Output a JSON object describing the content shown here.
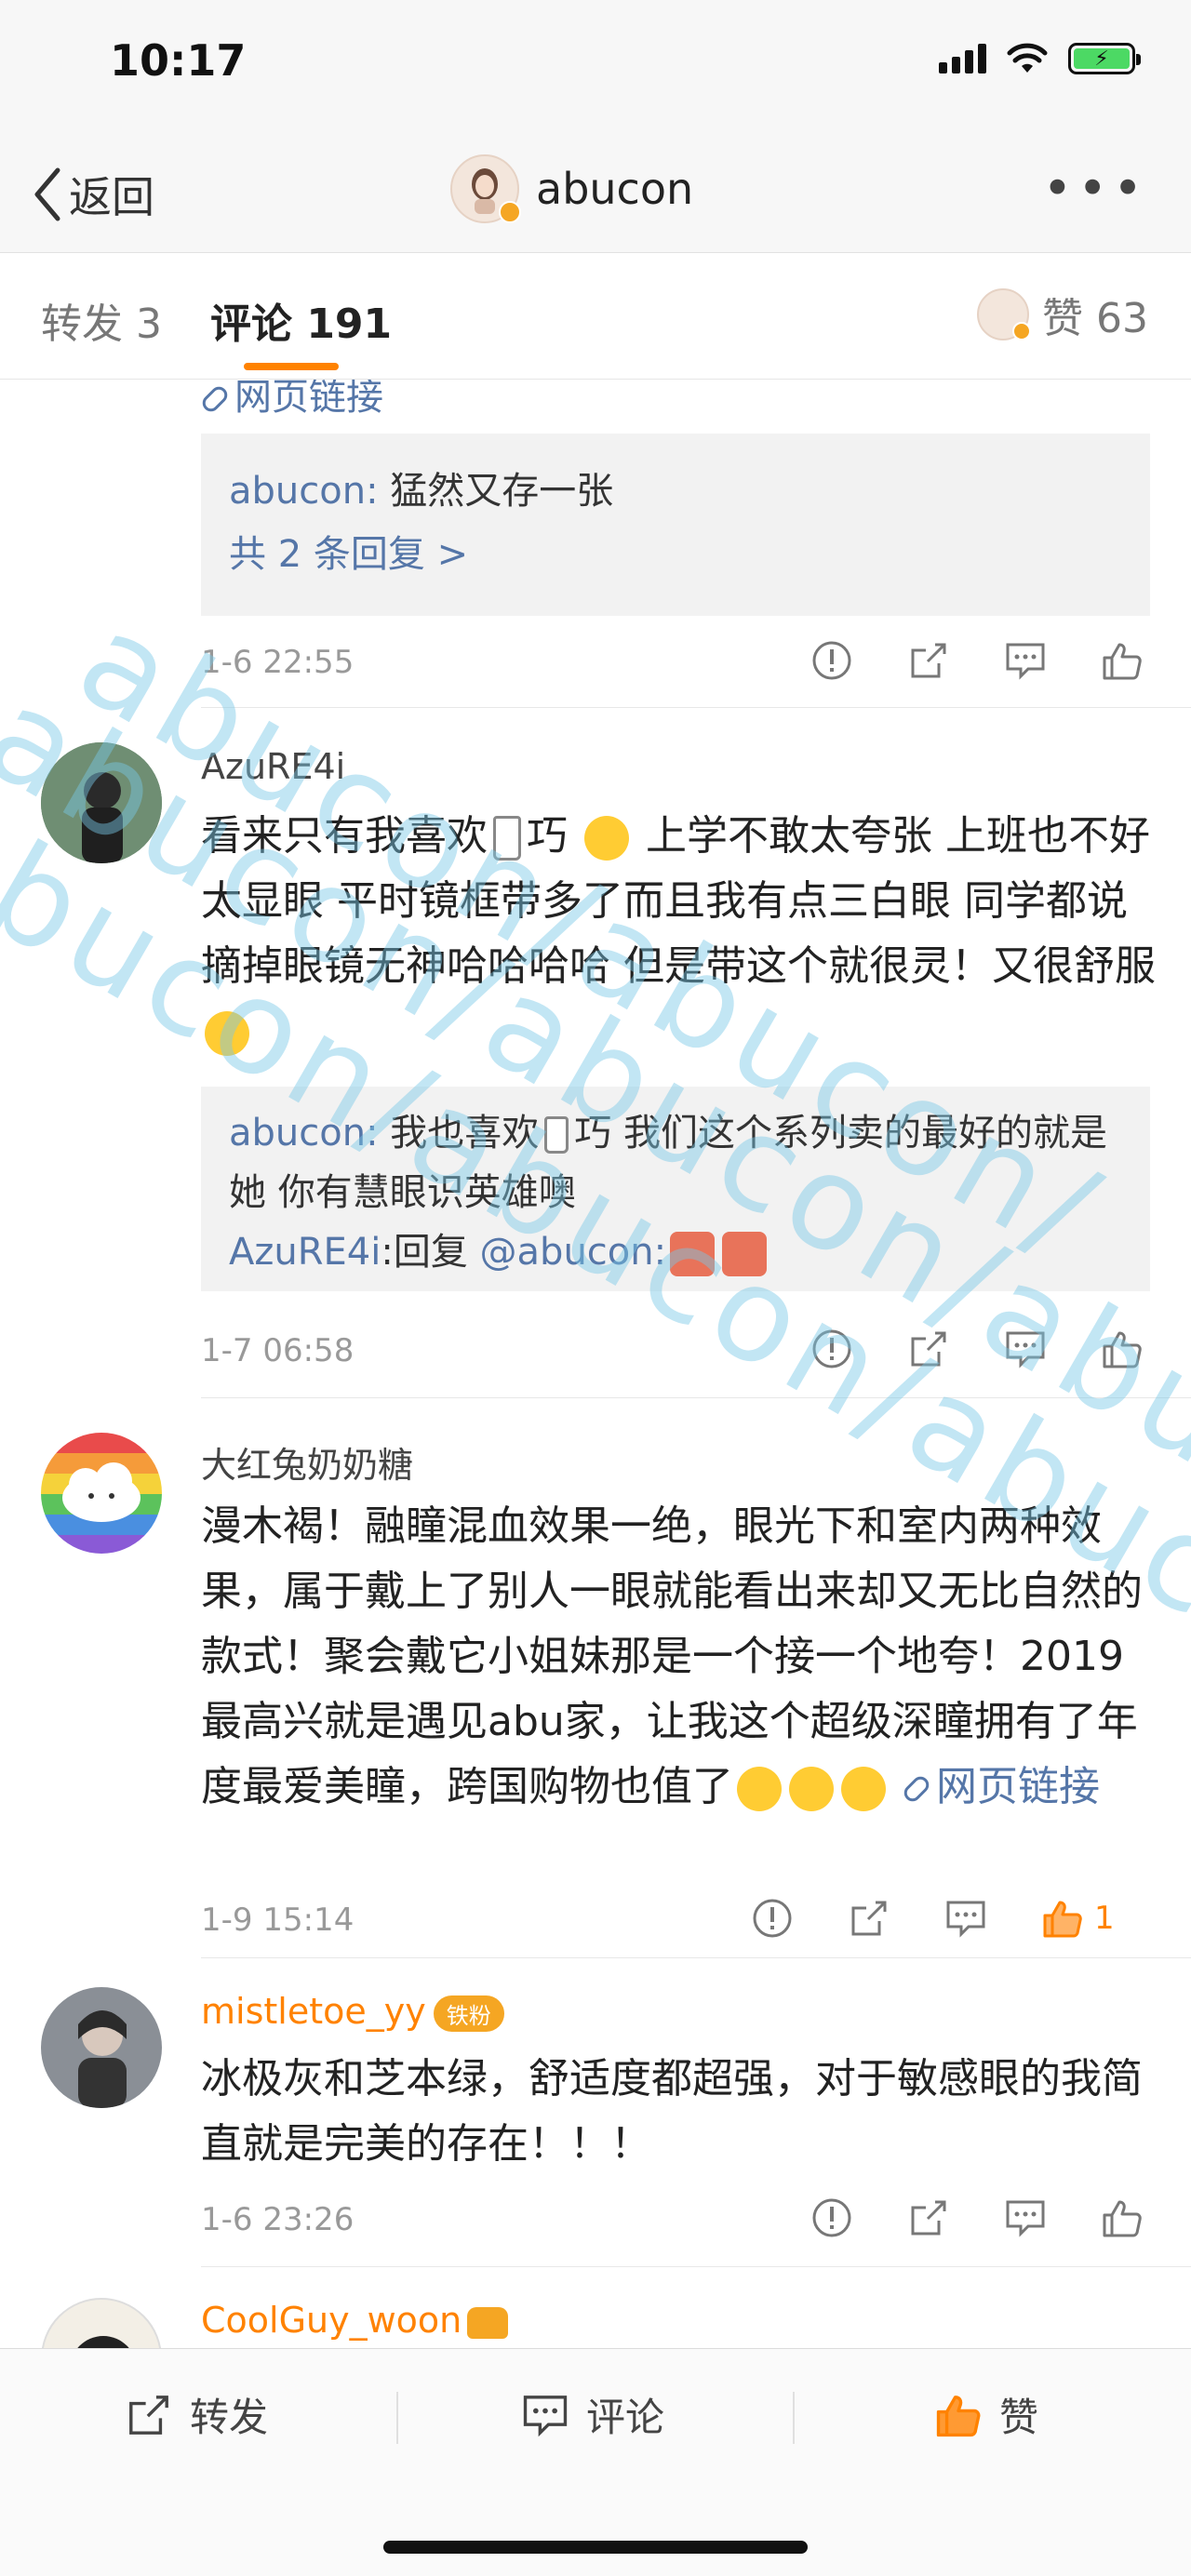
{
  "status_bar": {
    "time": "10:17"
  },
  "nav": {
    "back_label": "返回",
    "title": "abucon",
    "more": "•••"
  },
  "tabs": {
    "repost": "转发 3",
    "comments": "评论 191",
    "likes": "赞 63"
  },
  "top_partial": {
    "link_label": "网页链接",
    "reply_author": "abucon:",
    "reply_text": " 猛然又存一张",
    "reply_more": "共 2 条回复 >",
    "time": "1-6 22:55"
  },
  "comments": [
    {
      "username": "AzuRE4i",
      "text_1": "看来只有我喜欢",
      "text_2": "巧",
      "text_3": "上学不敢太夸张 上班也不好太显眼 平时镜框带多了而且我有点三白眼 同学都说摘掉眼镜无神哈哈哈哈 但是带这个就很灵！又很舒服",
      "reply_1_author": "abucon:",
      "reply_1_text_a": " 我也喜欢",
      "reply_1_text_b": "巧 我们这个系列卖的最好的就是她 你有慧眼识英雄噢",
      "reply_2_author": "AzuRE4i",
      "reply_2_text": ":回复 ",
      "reply_2_mention": "@abucon:",
      "time": "1-7 06:58"
    },
    {
      "username": "大红兔奶奶糖",
      "text": "漫木褐！融瞳混血效果一绝，眼光下和室内两种效果，属于戴上了别人一眼就能看出来却又无比自然的款式！聚会戴它小姐妹那是一个接一个地夸！2019最高兴就是遇见abu家，让我这个超级深瞳拥有了年度最爱美瞳，跨国购物也值了",
      "link_label": "网页链接",
      "time": "1-9 15:14",
      "like_count": "1"
    },
    {
      "username": "mistletoe_yy",
      "badge": "铁粉",
      "text": "冰极灰和芝本绿，舒适度都超强，对于敏感眼的我简直就是完美的存在！！！",
      "time": "1-6 23:26"
    },
    {
      "username": "CoolGuy_woon"
    }
  ],
  "bottom_bar": {
    "repost": "转发",
    "comment": "评论",
    "like": "赞"
  },
  "watermark": [
    "abucon/abucon/",
    "abucon/abucon/abucon/",
    "abucon/abucon/abucon/"
  ],
  "colors": {
    "accent": "#ff8200",
    "link": "#5576a8",
    "timestamp": "#999999",
    "watermark": "#78c8e6"
  }
}
